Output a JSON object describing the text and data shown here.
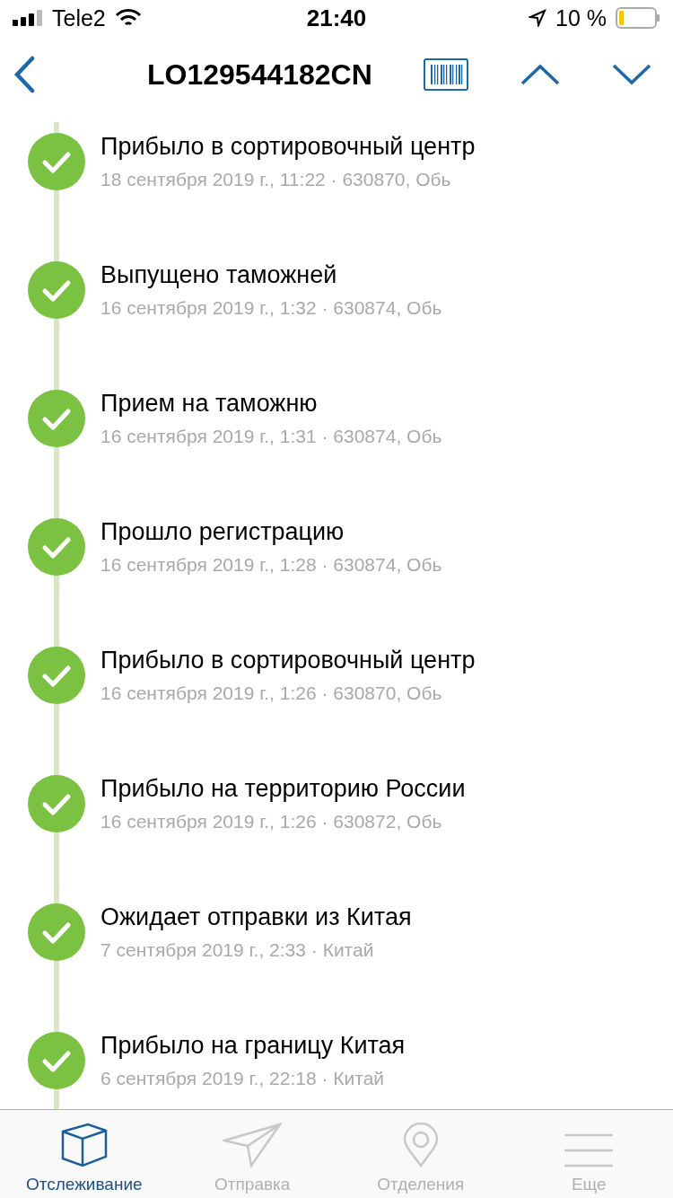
{
  "status_bar": {
    "carrier": "Tele2",
    "time": "21:40",
    "battery": "10 %"
  },
  "header": {
    "title": "LO129544182CN"
  },
  "events": [
    {
      "title": "Прибыло в сортировочный центр",
      "details": "18 сентября 2019 г., 11:22 · 630870, Обь"
    },
    {
      "title": "Выпущено таможней",
      "details": "16 сентября 2019 г., 1:32 · 630874, Обь"
    },
    {
      "title": "Прием на таможню",
      "details": "16 сентября 2019 г., 1:31 · 630874, Обь"
    },
    {
      "title": "Прошло регистрацию",
      "details": "16 сентября 2019 г., 1:28 · 630874, Обь"
    },
    {
      "title": "Прибыло в сортировочный центр",
      "details": "16 сентября 2019 г., 1:26 · 630870, Обь"
    },
    {
      "title": "Прибыло на территорию России",
      "details": "16 сентября 2019 г., 1:26 · 630872, Обь"
    },
    {
      "title": "Ожидает отправки из Китая",
      "details": "7 сентября 2019 г., 2:33 · Китай"
    },
    {
      "title": "Прибыло на границу Китая",
      "details": "6 сентября 2019 г., 22:18 · Китай"
    }
  ],
  "tab_bar": [
    {
      "kind": "box",
      "label": "Отслеживание",
      "selected": true
    },
    {
      "kind": "send",
      "label": "Отправка",
      "selected": false
    },
    {
      "kind": "pin",
      "label": "Отделения",
      "selected": false
    },
    {
      "kind": "menu",
      "label": "Еще",
      "selected": false
    }
  ]
}
